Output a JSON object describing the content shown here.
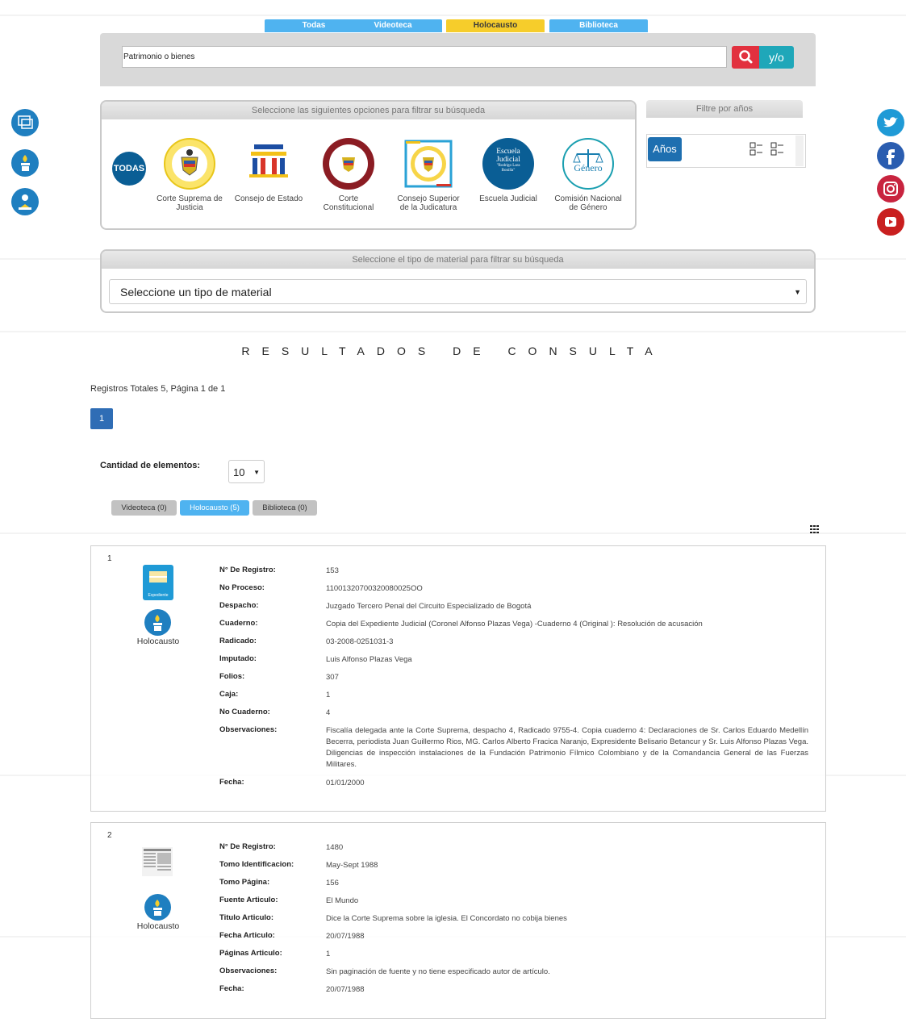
{
  "top_tabs": [
    "Todas",
    "Videoteca",
    "Holocausto",
    "Biblioteca"
  ],
  "search": {
    "value": "Patrimonio o bienes",
    "yo_label": "y/o"
  },
  "filters": {
    "institutions_header": "Seleccione las siguientes opciones para filtrar su búsqueda",
    "todas_label": "TODAS",
    "institutions": [
      "Corte Suprema de Justicia",
      "Consejo de Estado",
      "Corte Constitucional",
      "Consejo Superior de la Judicatura",
      "Escuela Judicial",
      "Comisión Nacional de Género"
    ],
    "escuela_logo_text": [
      "Escuela",
      "Judicial",
      "\"Rodrigo Lara",
      "Bonilla\""
    ],
    "genero_logo_text": "Género",
    "years_header": "Filtre por años",
    "years_button": "Años",
    "material_header": "Seleccione el tipo de material para filtrar su búsqueda",
    "material_select": "Seleccione un tipo de material"
  },
  "results": {
    "title": "RESULTADOS DE CONSULTA",
    "total_text": "Registros Totales 5, Página 1 de 1",
    "page": "1",
    "qty_label": "Cantidad de elementos:",
    "qty_value": "10",
    "tabs": [
      "Videoteca (0)",
      "Holocausto (5)",
      "Biblioteca (0)"
    ]
  },
  "records": [
    {
      "num": "1",
      "thumb_label": "Expediente",
      "category": "Holocausto",
      "fields": [
        {
          "k": "N° De Registro:",
          "v": "153"
        },
        {
          "k": "No Proceso:",
          "v": "11001320700320080025OO"
        },
        {
          "k": "Despacho:",
          "v": "Juzgado Tercero Penal del Circuito Especializado de Bogotá"
        },
        {
          "k": "Cuaderno:",
          "v": "Copia del Expediente Judicial (Coronel Alfonso Plazas Vega) -Cuaderno 4 (Original ): Resolución de acusación"
        },
        {
          "k": "Radicado:",
          "v": "03-2008-0251031-3"
        },
        {
          "k": "Imputado:",
          "v": "Luis Alfonso Plazas Vega"
        },
        {
          "k": "Folios:",
          "v": "307"
        },
        {
          "k": "Caja:",
          "v": "1"
        },
        {
          "k": "No Cuaderno:",
          "v": "4"
        },
        {
          "k": "Observaciones:",
          "v": "Fiscalía delegada ante la Corte Suprema, despacho 4, Radicado 9755-4. Copia cuaderno 4: Declaraciones de Sr. Carlos Eduardo Medellín Becerra, periodista Juan Guillermo Rios, MG. Carlos Alberto Fracica Naranjo, Expresidente Belisario Betancur y Sr. Luis Alfonso Plazas Vega. Diligencias de inspección instalaciones de la Fundación Patrimonio Fílmico Colombiano y de la Comandancia General de las Fuerzas Militares."
        },
        {
          "k": "Fecha:",
          "v": "01/01/2000"
        }
      ]
    },
    {
      "num": "2",
      "category": "Holocausto",
      "fields": [
        {
          "k": "N° De Registro:",
          "v": "1480"
        },
        {
          "k": "Tomo Identificacion:",
          "v": "May-Sept 1988"
        },
        {
          "k": "Tomo Página:",
          "v": "156"
        },
        {
          "k": "Fuente Articulo:",
          "v": "El Mundo"
        },
        {
          "k": "Titulo Articulo:",
          "v": "Dice la Corte Suprema sobre la iglesia. El Concordato no cobija bienes"
        },
        {
          "k": "Fecha Articulo:",
          "v": "20/07/1988"
        },
        {
          "k": "Páginas Articulo:",
          "v": "1"
        },
        {
          "k": "Observaciones:",
          "v": "Sin paginación de fuente y no tiene especificado autor de artículo."
        },
        {
          "k": "Fecha:",
          "v": "20/07/1988"
        }
      ]
    }
  ],
  "colors": {
    "accent_blue": "#4fb3f0",
    "holocausto_yellow": "#f6cd2b",
    "search_red": "#e2313f",
    "yo_teal": "#1fa7b9",
    "dark_blue": "#1e6fb0"
  },
  "social_icons": [
    "twitter-icon",
    "facebook-icon",
    "instagram-icon",
    "youtube-icon"
  ],
  "left_icons": [
    "videoteca-icon",
    "holocausto-icon",
    "biblioteca-icon"
  ]
}
